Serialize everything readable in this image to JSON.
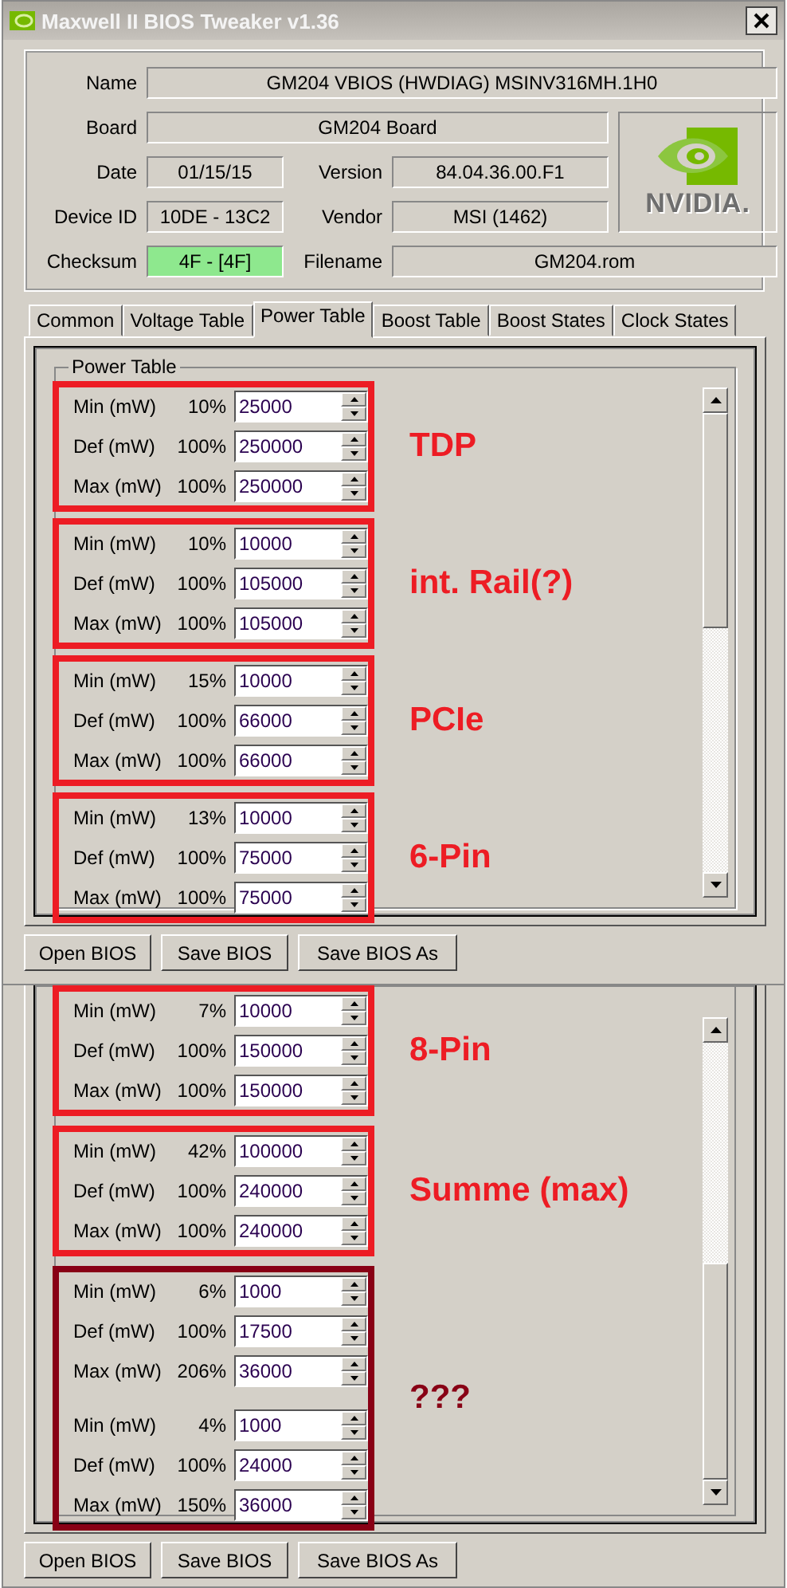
{
  "window": {
    "title": "Maxwell II BIOS Tweaker v1.36"
  },
  "info": [
    {
      "label": "Name",
      "value": "GM204 VBIOS (HWDIAG) MSINV316MH.1H0",
      "highlighted": false
    },
    {
      "label": "Board",
      "value": "GM204 Board",
      "highlighted": false
    },
    {
      "label": "Date",
      "value": "01/15/15",
      "highlighted": false
    },
    {
      "label": "Version",
      "value": "84.04.36.00.F1",
      "highlighted": false
    },
    {
      "label": "Device ID",
      "value": "10DE - 13C2",
      "highlighted": false
    },
    {
      "label": "Vendor",
      "value": "MSI (1462)",
      "highlighted": false
    },
    {
      "label": "Checksum",
      "value": "4F - [4F]",
      "highlighted": true
    },
    {
      "label": "Filename",
      "value": "GM204.rom",
      "highlighted": false
    }
  ],
  "logo": {
    "text": "NVIDIA."
  },
  "tabs": [
    {
      "label": "Common",
      "selected": false
    },
    {
      "label": "Voltage Table",
      "selected": false
    },
    {
      "label": "Power Table",
      "selected": true
    },
    {
      "label": "Boost Table",
      "selected": false
    },
    {
      "label": "Boost States",
      "selected": false
    },
    {
      "label": "Clock States",
      "selected": false
    }
  ],
  "top_panel": {
    "group_title": "Power Table",
    "groups": [
      {
        "annotation": "TDP",
        "color": "#ed1c24",
        "blocks": [
          [
            {
              "label": "Min (mW)",
              "percent": "10%",
              "value": "25000"
            },
            {
              "label": "Def (mW)",
              "percent": "100%",
              "value": "250000"
            },
            {
              "label": "Max (mW)",
              "percent": "100%",
              "value": "250000"
            }
          ]
        ]
      },
      {
        "annotation": "int. Rail(?)",
        "color": "#ed1c24",
        "blocks": [
          [
            {
              "label": "Min (mW)",
              "percent": "10%",
              "value": "10000"
            },
            {
              "label": "Def (mW)",
              "percent": "100%",
              "value": "105000"
            },
            {
              "label": "Max (mW)",
              "percent": "100%",
              "value": "105000"
            }
          ]
        ]
      },
      {
        "annotation": "PCIe",
        "color": "#ed1c24",
        "blocks": [
          [
            {
              "label": "Min (mW)",
              "percent": "15%",
              "value": "10000"
            },
            {
              "label": "Def (mW)",
              "percent": "100%",
              "value": "66000"
            },
            {
              "label": "Max (mW)",
              "percent": "100%",
              "value": "66000"
            }
          ]
        ]
      },
      {
        "annotation": "6-Pin",
        "color": "#ed1c24",
        "blocks": [
          [
            {
              "label": "Min (mW)",
              "percent": "13%",
              "value": "10000"
            },
            {
              "label": "Def (mW)",
              "percent": "100%",
              "value": "75000"
            },
            {
              "label": "Max (mW)",
              "percent": "100%",
              "value": "75000"
            }
          ]
        ]
      }
    ]
  },
  "top_buttons": [
    "Open BIOS",
    "Save BIOS",
    "Save BIOS As"
  ],
  "bottom_panel": {
    "groups": [
      {
        "annotation": "8-Pin",
        "color": "#ed1c24",
        "blocks": [
          [
            {
              "label": "Min (mW)",
              "percent": "7%",
              "value": "10000"
            },
            {
              "label": "Def (mW)",
              "percent": "100%",
              "value": "150000"
            },
            {
              "label": "Max (mW)",
              "percent": "100%",
              "value": "150000"
            }
          ]
        ]
      },
      {
        "annotation": "Summe (max)",
        "color": "#ed1c24",
        "blocks": [
          [
            {
              "label": "Min (mW)",
              "percent": "42%",
              "value": "100000"
            },
            {
              "label": "Def (mW)",
              "percent": "100%",
              "value": "240000"
            },
            {
              "label": "Max (mW)",
              "percent": "100%",
              "value": "240000"
            }
          ]
        ]
      },
      {
        "annotation": "???",
        "color": "#880015",
        "blocks": [
          [
            {
              "label": "Min (mW)",
              "percent": "6%",
              "value": "1000"
            },
            {
              "label": "Def (mW)",
              "percent": "100%",
              "value": "17500"
            },
            {
              "label": "Max (mW)",
              "percent": "206%",
              "value": "36000"
            }
          ],
          [
            {
              "label": "Min (mW)",
              "percent": "4%",
              "value": "1000"
            },
            {
              "label": "Def (mW)",
              "percent": "100%",
              "value": "24000"
            },
            {
              "label": "Max (mW)",
              "percent": "150%",
              "value": "36000"
            }
          ]
        ]
      }
    ]
  },
  "bottom_buttons": [
    "Open BIOS",
    "Save BIOS",
    "Save BIOS As"
  ]
}
